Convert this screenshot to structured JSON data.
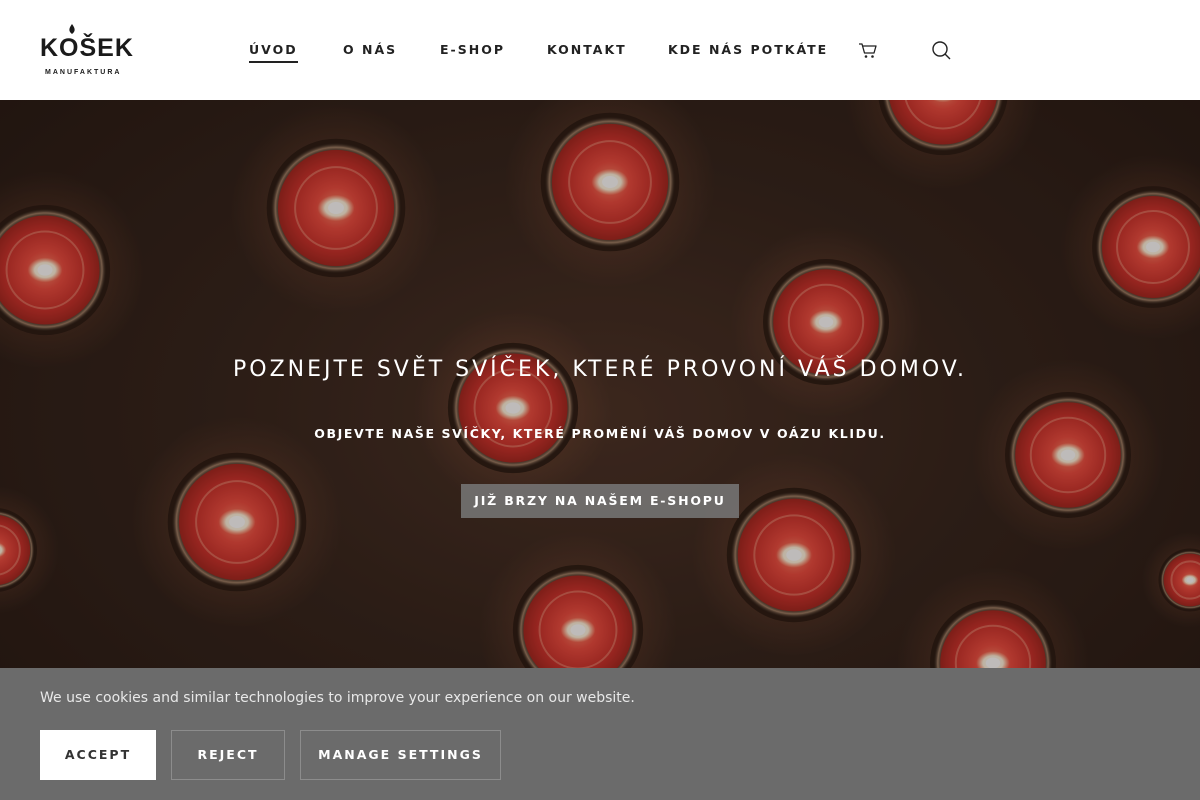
{
  "brand": {
    "name": "KOŠEK",
    "tagline": "MANUFAKTURA"
  },
  "nav": {
    "items": [
      {
        "label": "ÚVOD",
        "active": true
      },
      {
        "label": "O NÁS",
        "active": false
      },
      {
        "label": "E-SHOP",
        "active": false
      },
      {
        "label": "KONTAKT",
        "active": false
      },
      {
        "label": "KDE NÁS POTKÁTE",
        "active": false
      }
    ],
    "cart_icon": "cart-icon",
    "search_icon": "search-icon"
  },
  "hero": {
    "title": "POZNEJTE SVĚT SVÍČEK, KTERÉ PROVONÍ VÁŠ DOMOV.",
    "subtitle": "OBJEVTE NAŠE SVÍČKY, KTERÉ PROMĚNÍ VÁŠ DOMOV V OÁZU KLIDU.",
    "button_label": "JIŽ BRZY NA NAŠEM E-SHOPU"
  },
  "cookie": {
    "text": "We use cookies and similar technologies to improve your experience on our website.",
    "accept_label": "ACCEPT",
    "reject_label": "REJECT",
    "manage_label": "MANAGE SETTINGS"
  },
  "colors": {
    "header_bg": "#ffffff",
    "candle_red": "#e2453a",
    "cookie_bg": "#6b6b6b"
  }
}
